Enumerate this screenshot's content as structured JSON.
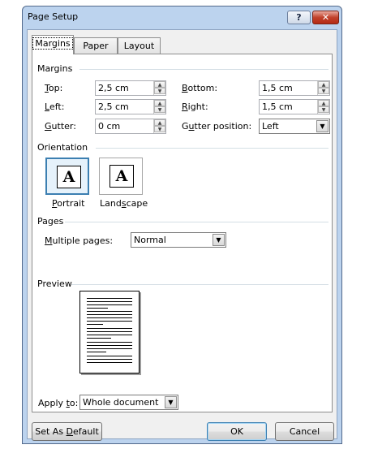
{
  "window": {
    "title": "Page Setup",
    "help_label": "?",
    "close_label": "✕"
  },
  "tabs": [
    {
      "label": "Margins",
      "active": true
    },
    {
      "label": "Paper",
      "active": false
    },
    {
      "label": "Layout",
      "active": false
    }
  ],
  "margins": {
    "group_title": "Margins",
    "top": {
      "label": "Top:",
      "value": "2,5 cm"
    },
    "left": {
      "label": "Left:",
      "value": "2,5 cm"
    },
    "gutter": {
      "label": "Gutter:",
      "value": "0 cm"
    },
    "bottom": {
      "label": "Bottom:",
      "value": "1,5 cm"
    },
    "right": {
      "label": "Right:",
      "value": "1,5 cm"
    },
    "gutter_position": {
      "label": "Gutter position:",
      "value": "Left"
    }
  },
  "orientation": {
    "group_title": "Orientation",
    "portrait_label": "Portrait",
    "landscape_label": "Landscape",
    "icon_letter": "A",
    "selected": "portrait"
  },
  "pages": {
    "group_title": "Pages",
    "multiple_pages_label": "Multiple pages:",
    "multiple_pages_value": "Normal"
  },
  "preview": {
    "group_title": "Preview"
  },
  "apply_to": {
    "label": "Apply to:",
    "value": "Whole document"
  },
  "buttons": {
    "set_default": "Set As Default",
    "ok": "OK",
    "cancel": "Cancel"
  },
  "colors": {
    "frame": "#bcd3ee",
    "accent": "#3c7fb1",
    "close": "#c1422b"
  }
}
